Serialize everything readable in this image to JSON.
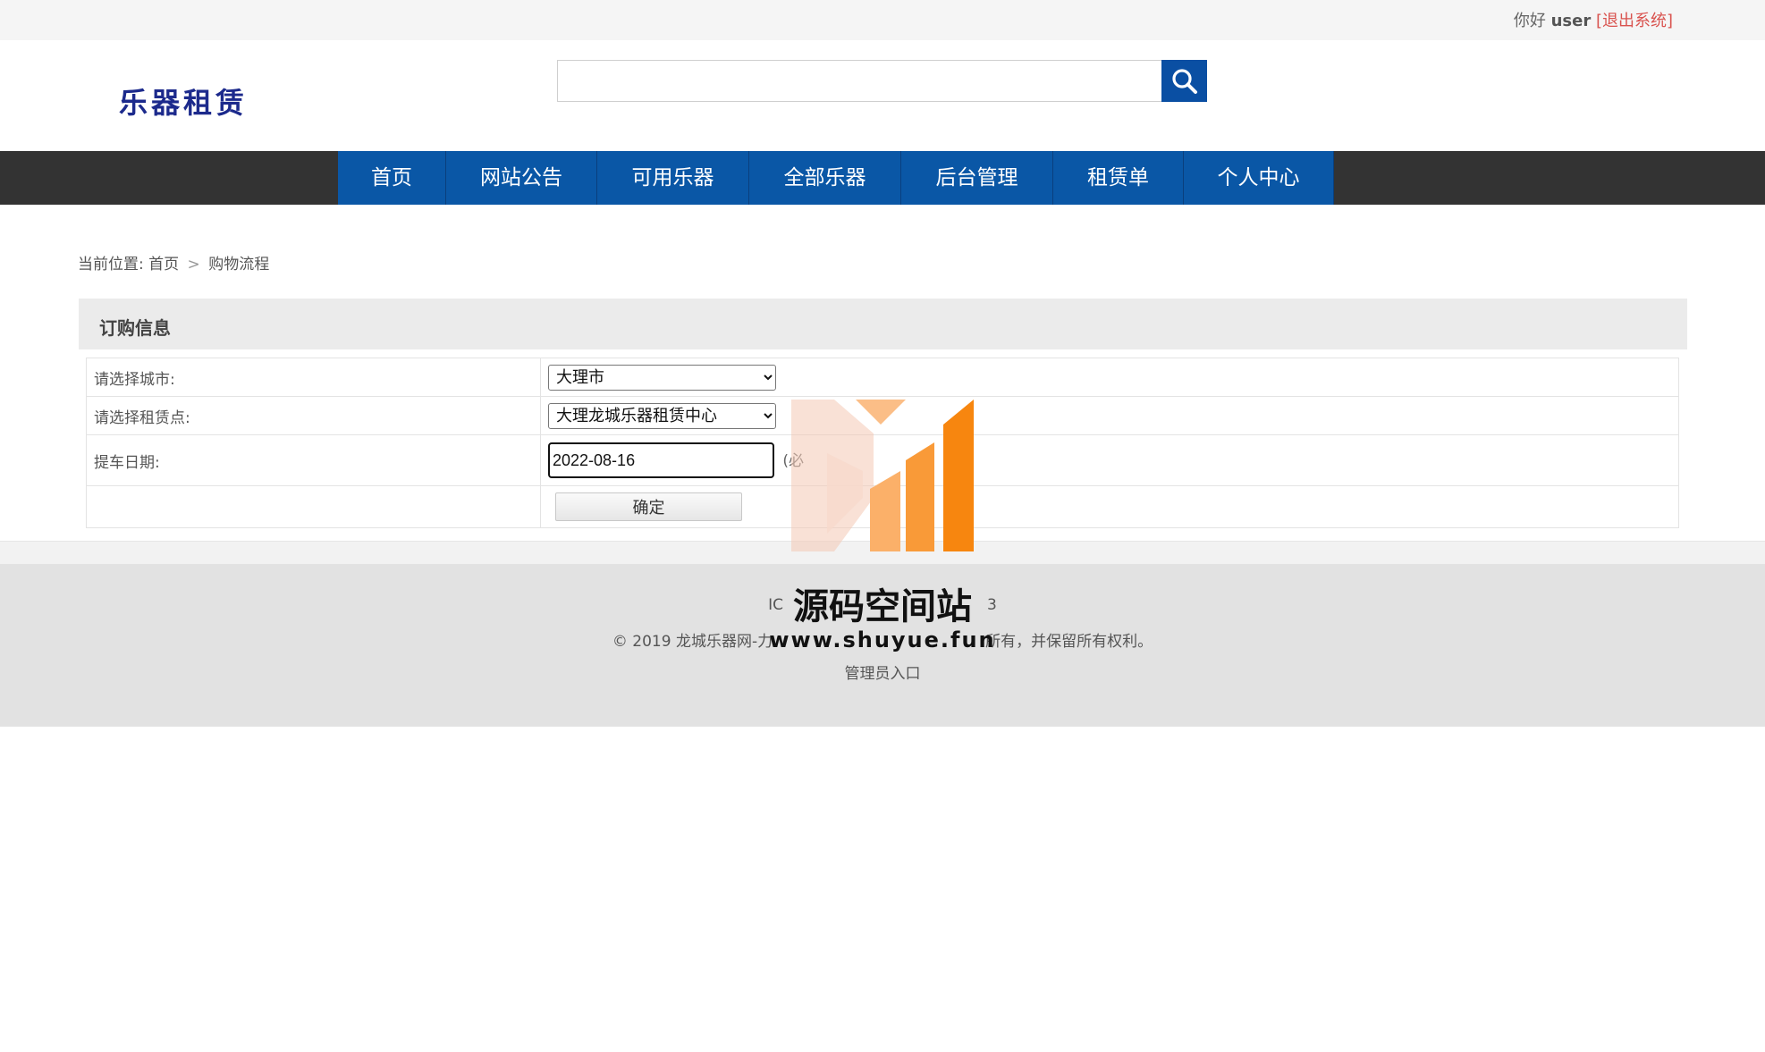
{
  "topbar": {
    "greeting_prefix": "你好",
    "username": "user",
    "logout": "[退出系统]"
  },
  "logo": "乐器租赁",
  "search": {
    "value": "",
    "button_icon": "search-icon"
  },
  "nav": [
    {
      "label": "首页"
    },
    {
      "label": "网站公告"
    },
    {
      "label": "可用乐器"
    },
    {
      "label": "全部乐器"
    },
    {
      "label": "后台管理"
    },
    {
      "label": "租赁单"
    },
    {
      "label": "个人中心"
    }
  ],
  "breadcrumb": {
    "prefix": "当前位置:",
    "home": "首页",
    "separator": ">",
    "current": "购物流程"
  },
  "section": {
    "title": "订购信息"
  },
  "form": {
    "city_label": "请选择城市:",
    "city_value": "大理市",
    "store_label": "请选择租赁点:",
    "store_value": "大理龙城乐器租赁中心",
    "date_label": "提车日期:",
    "date_value": "2022-08-16",
    "date_hint": "(必",
    "submit": "确定"
  },
  "footer": {
    "icp": "IC",
    "icp_tail": "3",
    "copyright_start": "© 2019 龙城乐器网-力",
    "copyright_end": "所有，并保留所有权利。",
    "admin_link": "管理员入口"
  },
  "watermark": {
    "title": "源码空间站",
    "url": "www.shuyue.fun"
  },
  "colors": {
    "nav_blue": "#0a57a6",
    "nav_bar": "#333333",
    "search_btn": "#0a4fa3",
    "logout": "#d9534f",
    "logo": "#1c2a8c"
  }
}
